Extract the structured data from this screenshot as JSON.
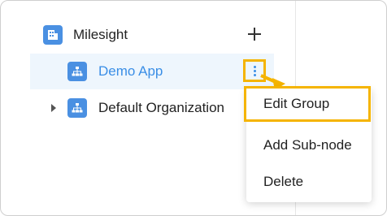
{
  "tree": {
    "root": {
      "label": "Milesight",
      "icon": "organization-icon"
    },
    "child": {
      "label": "Demo App",
      "icon": "group-tree-icon"
    },
    "sibling": {
      "label": "Default Organization",
      "icon": "group-tree-icon"
    }
  },
  "context_menu": {
    "items": [
      "Edit Group",
      "Add Sub-node",
      "Delete"
    ]
  },
  "colors": {
    "accent": "#3a8ee6",
    "icon_bg": "#4a90e2",
    "highlight": "#f5b400",
    "selected_bg": "#eef6fd"
  }
}
